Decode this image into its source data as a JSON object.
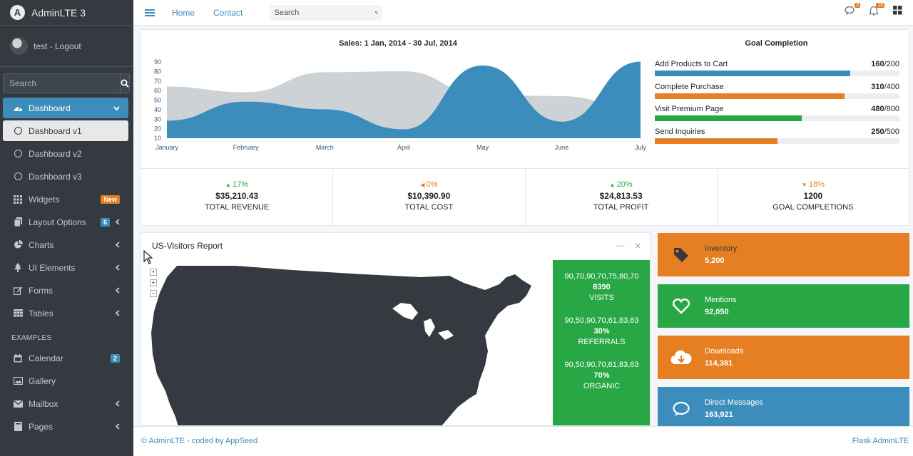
{
  "brand": {
    "name": "AdminLTE 3"
  },
  "user": {
    "name": "test - Logout"
  },
  "sidebar": {
    "search_placeholder": "Search",
    "items": [
      {
        "label": "Dashboard",
        "icon": "dashboard-icon"
      },
      {
        "label": "Dashboard v1",
        "icon": "circle-icon"
      },
      {
        "label": "Dashboard v2",
        "icon": "circle-icon"
      },
      {
        "label": "Dashboard v3",
        "icon": "circle-icon"
      },
      {
        "label": "Widgets",
        "icon": "widgets-icon",
        "badge": "New"
      },
      {
        "label": "Layout Options",
        "icon": "layout-icon",
        "badge": "6"
      },
      {
        "label": "Charts",
        "icon": "pie-chart-icon"
      },
      {
        "label": "UI Elements",
        "icon": "tree-icon"
      },
      {
        "label": "Forms",
        "icon": "edit-icon"
      },
      {
        "label": "Tables",
        "icon": "table-icon"
      }
    ],
    "examples_header": "EXAMPLES",
    "examples": [
      {
        "label": "Calendar",
        "icon": "calendar-icon",
        "badge": "2"
      },
      {
        "label": "Gallery",
        "icon": "image-icon"
      },
      {
        "label": "Mailbox",
        "icon": "envelope-icon"
      },
      {
        "label": "Pages",
        "icon": "book-icon"
      }
    ]
  },
  "topnav": {
    "links": [
      "Home",
      "Contact"
    ],
    "search_placeholder": "Search",
    "messages_count": "3",
    "notifications_count": "15"
  },
  "sales": {
    "title": "Sales: 1 Jan, 2014 - 30 Jul, 2014",
    "goal_title": "Goal Completion",
    "goals": [
      {
        "label": "Add Products to Cart",
        "value": "160",
        "total": "/200",
        "fraction": 0.8,
        "color": "#3c8dbc"
      },
      {
        "label": "Complete Purchase",
        "value": "310",
        "total": "/400",
        "fraction": 0.775,
        "color": "#e67e22"
      },
      {
        "label": "Visit Premium Page",
        "value": "480",
        "total": "/800",
        "fraction": 0.6,
        "color": "#28a745"
      },
      {
        "label": "Send Inquiries",
        "value": "250",
        "total": "/500",
        "fraction": 0.5,
        "color": "#e67e22"
      }
    ],
    "stats": [
      {
        "pct": "17%",
        "arrow": "up",
        "amount": "$35,210.43",
        "label": "TOTAL REVENUE",
        "color": "#28a745"
      },
      {
        "pct": "0%",
        "arrow": "left",
        "amount": "$10,390.90",
        "label": "TOTAL COST",
        "color": "#e67e22"
      },
      {
        "pct": "20%",
        "arrow": "up",
        "amount": "$24,813.53",
        "label": "TOTAL PROFIT",
        "color": "#28a745"
      },
      {
        "pct": "18%",
        "arrow": "down",
        "amount": "1200",
        "label": "GOAL COMPLETIONS",
        "color": "#e67e22"
      }
    ]
  },
  "chart_data": {
    "type": "area",
    "categories": [
      "January",
      "February",
      "March",
      "April",
      "May",
      "June",
      "July"
    ],
    "ylim": [
      10,
      90
    ],
    "yticks": [
      10,
      20,
      30,
      40,
      50,
      60,
      70,
      80,
      90
    ],
    "series": [
      {
        "values": [
          65,
          59,
          80,
          81,
          56,
          55,
          40
        ],
        "color": "#cdd2d6"
      },
      {
        "values": [
          28,
          48,
          40,
          19,
          86,
          27,
          90
        ],
        "color": "#3c8dbc"
      }
    ]
  },
  "visitors": {
    "title": "US-Visitors Report",
    "stats": [
      {
        "sparkline": "90,70,90,70,75,80,70",
        "value": "8390",
        "label": "VISITS"
      },
      {
        "sparkline": "90,50,90,70,61,83,63",
        "value": "30%",
        "label": "REFERRALS"
      },
      {
        "sparkline": "90,50,90,70,61,83,63",
        "value": "70%",
        "label": "ORGANIC"
      }
    ]
  },
  "info_boxes": [
    {
      "label": "Inventory",
      "value": "5,200",
      "icon": "tag-icon",
      "color": "#e67e22"
    },
    {
      "label": "Mentions",
      "value": "92,050",
      "icon": "heart-icon",
      "color": "#28a745"
    },
    {
      "label": "Downloads",
      "value": "114,381",
      "icon": "cloud-download-icon",
      "color": "#e67e22"
    },
    {
      "label": "Direct Messages",
      "value": "163,921",
      "icon": "comment-icon",
      "color": "#3c8dbc"
    }
  ],
  "footer": {
    "left": "© AdminLTE - coded by AppSeed",
    "right": "Flask AdminLTE"
  }
}
